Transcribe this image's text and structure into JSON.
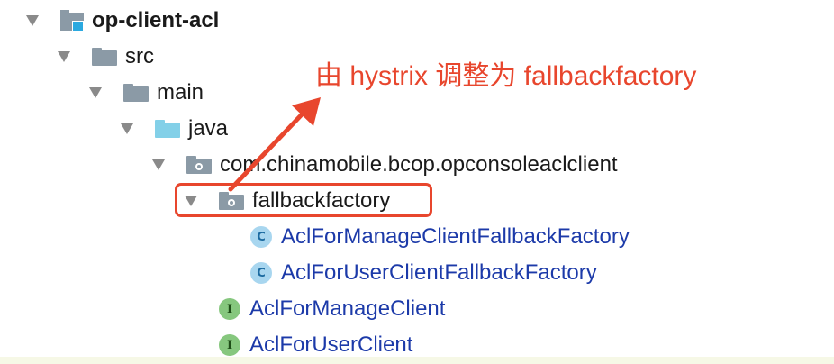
{
  "tree": {
    "project": {
      "label": "op-client-acl"
    },
    "src": {
      "label": "src"
    },
    "main": {
      "label": "main"
    },
    "java": {
      "label": "java"
    },
    "package": {
      "label": "com.chinamobile.bcop.opconsoleaclclient"
    },
    "subpackage": {
      "label": "fallbackfactory"
    },
    "classes": [
      {
        "label": "AclForManageClientFallbackFactory",
        "icon": "C"
      },
      {
        "label": "AclForUserClientFallbackFactory",
        "icon": "C"
      }
    ],
    "interfaces": [
      {
        "label": "AclForManageClient",
        "icon": "I"
      },
      {
        "label": "AclForUserClient",
        "icon": "I"
      }
    ]
  },
  "annotation": {
    "text": "由 hystrix 调整为 fallbackfactory",
    "color": "#e8462d"
  },
  "icons": {
    "expand": "triangle-down-icon",
    "folder": "folder-icon",
    "source_folder": "source-folder-icon",
    "package": "package-icon",
    "class": "class-icon",
    "interface": "interface-icon"
  }
}
